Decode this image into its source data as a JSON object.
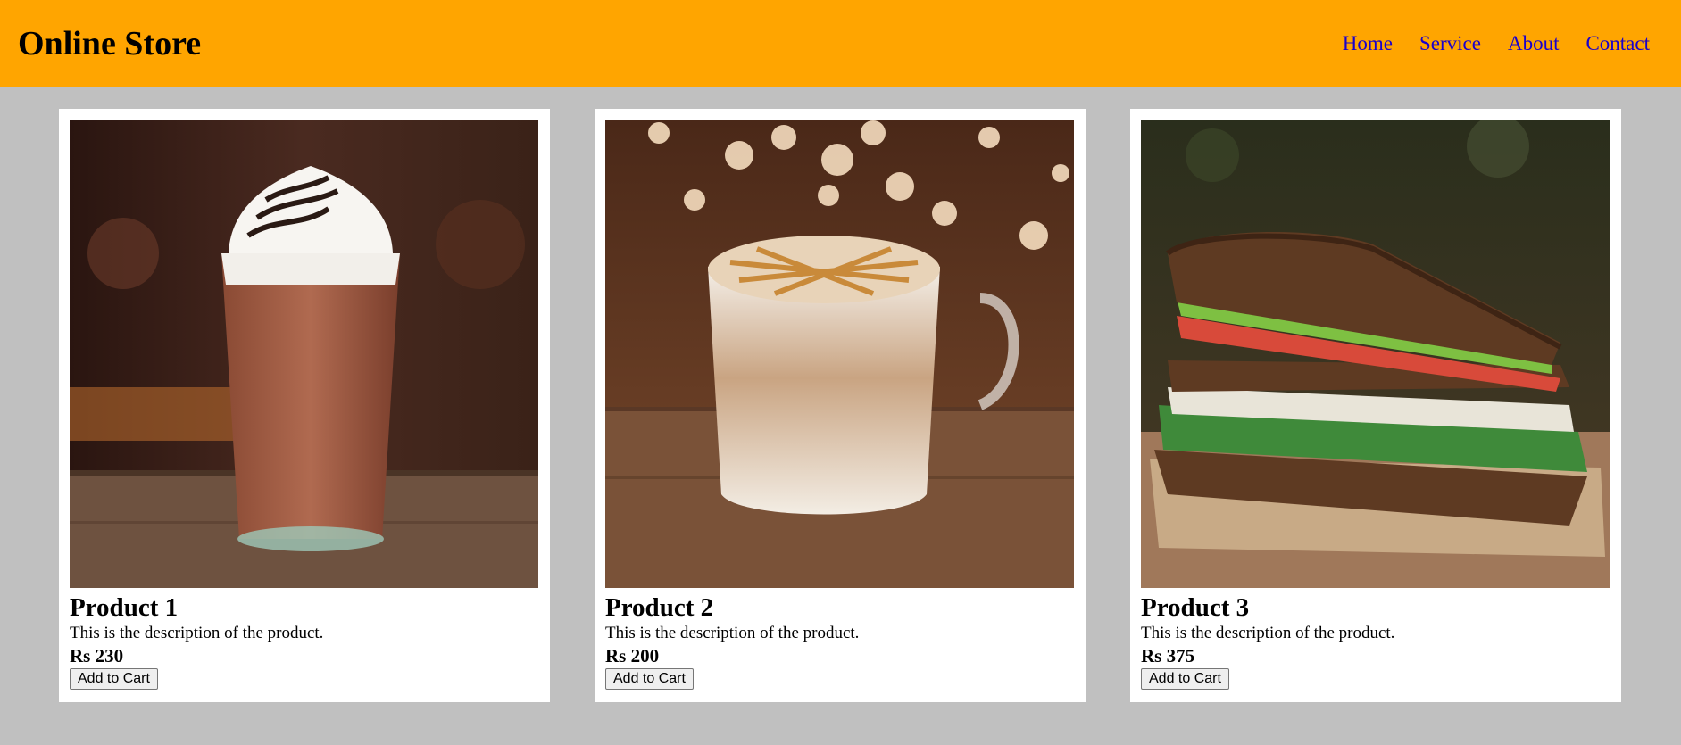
{
  "header": {
    "brand": "Online Store",
    "nav": [
      "Home",
      "Service",
      "About",
      "Contact"
    ]
  },
  "products": [
    {
      "title": "Product 1",
      "description": "This is the description of the product.",
      "price": "Rs 230",
      "button": "Add to Cart",
      "image": "iced-frappe-drink"
    },
    {
      "title": "Product 2",
      "description": "This is the description of the product.",
      "price": "Rs 200",
      "button": "Add to Cart",
      "image": "caramel-latte-mug"
    },
    {
      "title": "Product 3",
      "description": "This is the description of the product.",
      "price": "Rs 375",
      "button": "Add to Cart",
      "image": "vegetable-sandwich"
    }
  ],
  "colors": {
    "header_bg": "#ffa500",
    "page_bg": "#c0c0c0",
    "card_bg": "#ffffff",
    "nav_link": "#1a00cc"
  }
}
